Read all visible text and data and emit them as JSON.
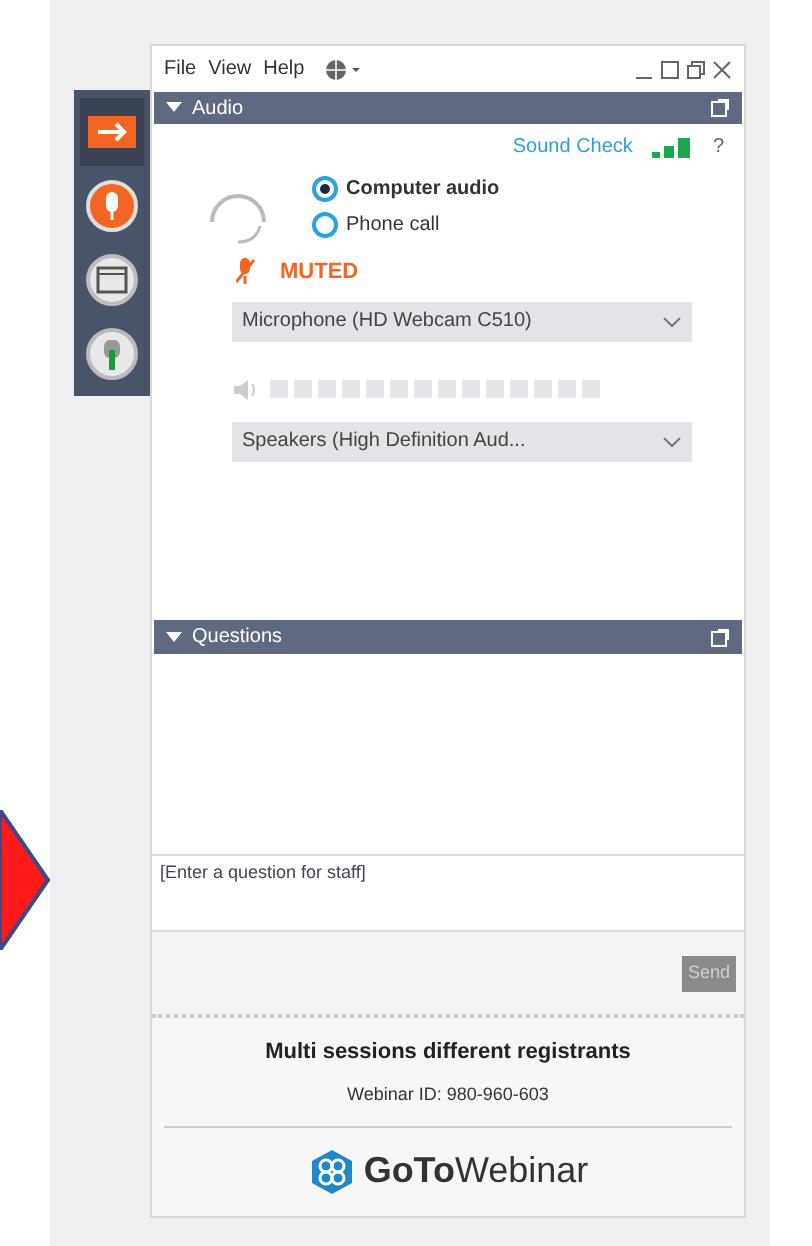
{
  "menu": [
    {
      "label": "File"
    },
    {
      "label": "View"
    },
    {
      "label": "Help"
    }
  ],
  "sidebar": {
    "items": [
      {
        "kind": "arrow",
        "selected": true
      },
      {
        "kind": "mic",
        "selected": false
      },
      {
        "kind": "screen",
        "selected": false
      },
      {
        "kind": "hand",
        "selected": false
      }
    ]
  },
  "audio": {
    "title": "Audio",
    "expanded": true,
    "sound_check": "Sound Check",
    "help": "?",
    "options": [
      {
        "label": "Computer audio",
        "selected": true
      },
      {
        "label": "Phone call",
        "selected": false
      }
    ],
    "mic_status": "MUTED",
    "microphone": "Microphone (HD Webcam C510)",
    "speaker_meter": {
      "level": 0
    },
    "speakers": "Speakers (High Definition Aud..."
  },
  "questions": {
    "title": "Questions",
    "expanded": true,
    "placeholder": "[Enter a question for staff]",
    "send": "Send",
    "send_disabled": true
  },
  "footer": {
    "title": "Multi sessions different registrants",
    "webinar_id": "Webinar ID: 980-960-603",
    "logo": "**GoTo**Webinar"
  }
}
